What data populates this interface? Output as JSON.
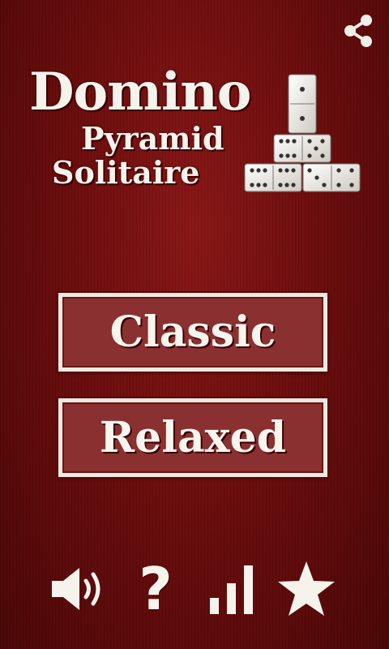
{
  "logo": {
    "line1": "Domino",
    "line2": "Pyramid",
    "line3": "Solitaire",
    "icon": "domino-pyramid-icon"
  },
  "top_bar": {
    "share_icon": "share-icon"
  },
  "menu": {
    "classic_label": "Classic",
    "relaxed_label": "Relaxed"
  },
  "bottom_bar": {
    "sound_icon": "speaker-sound-icon",
    "help_label": "?",
    "stats_icon": "bar-chart-icon",
    "rate_icon": "star-icon"
  },
  "colors": {
    "background": "#6c0c0c",
    "button_fill": "#8a3030",
    "button_border": "#eeeae2",
    "text": "#f6f3ec"
  }
}
